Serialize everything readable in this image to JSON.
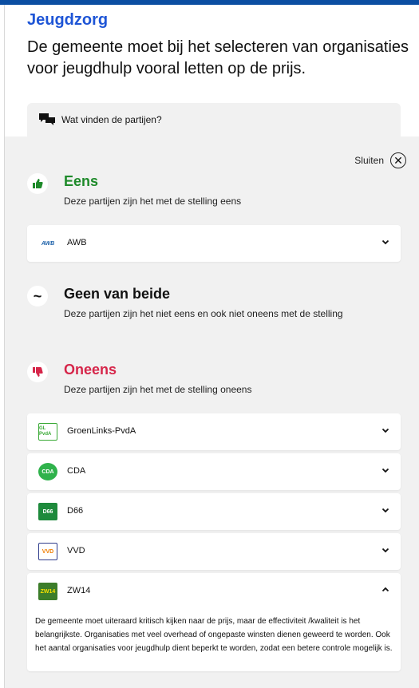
{
  "header": {
    "section": "Jeugdzorg",
    "statement": "De gemeente moet bij het selecteren van organisaties voor jeugdhulp vooral letten op de prijs."
  },
  "tab": {
    "label": "Wat vinden de partijen?",
    "icon": "chat-bubbles-icon"
  },
  "panel": {
    "close_label": "Sluiten",
    "groups": [
      {
        "key": "eens",
        "icon": "thumbs-up-icon",
        "title": "Eens",
        "title_color": "#1e8a2a",
        "description": "Deze partijen zijn het met de stelling eens"
      },
      {
        "key": "geen",
        "icon": "tilde-icon",
        "icon_glyph": "~",
        "title": "Geen van beide",
        "title_color": "#111111",
        "description": "Deze partijen zijn het niet eens en ook niet oneens met de stelling"
      },
      {
        "key": "oneens",
        "icon": "thumbs-down-icon",
        "title": "Oneens",
        "title_color": "#d6264a",
        "description": "Deze partijen zijn het met de stelling oneens"
      }
    ],
    "parties": [
      {
        "name": "AWB",
        "logo_text": "AWB",
        "logo_color": "#1a5fa8",
        "group": "eens"
      },
      {
        "name": "GroenLinks-PvdA",
        "logo_text": "GL PvdA",
        "logo_color": "#39a935",
        "group": "oneens"
      },
      {
        "name": "CDA",
        "logo_text": "CDA",
        "logo_color": "#2fb24b",
        "group": "oneens"
      },
      {
        "name": "D66",
        "logo_text": "D66",
        "logo_color": "#1e8a3c",
        "group": "oneens"
      },
      {
        "name": "VVD",
        "logo_text": "VVD",
        "logo_color": "#f07d00",
        "group": "oneens"
      },
      {
        "name": "ZW14",
        "logo_text": "ZW14",
        "logo_color": "#3c7d2a",
        "group": "oneens",
        "expanded": true,
        "explanation": "De gemeente moet uiteraard kritisch kijken naar de prijs, maar de effectiviteit /kwaliteit is het belangrijkste. Organisaties met veel overhead of ongepaste winsten dienen geweerd te worden. Ook het aantal organisaties voor jeugdhulp dient beperkt te worden, zodat een betere controle mogelijk is."
      }
    ]
  }
}
